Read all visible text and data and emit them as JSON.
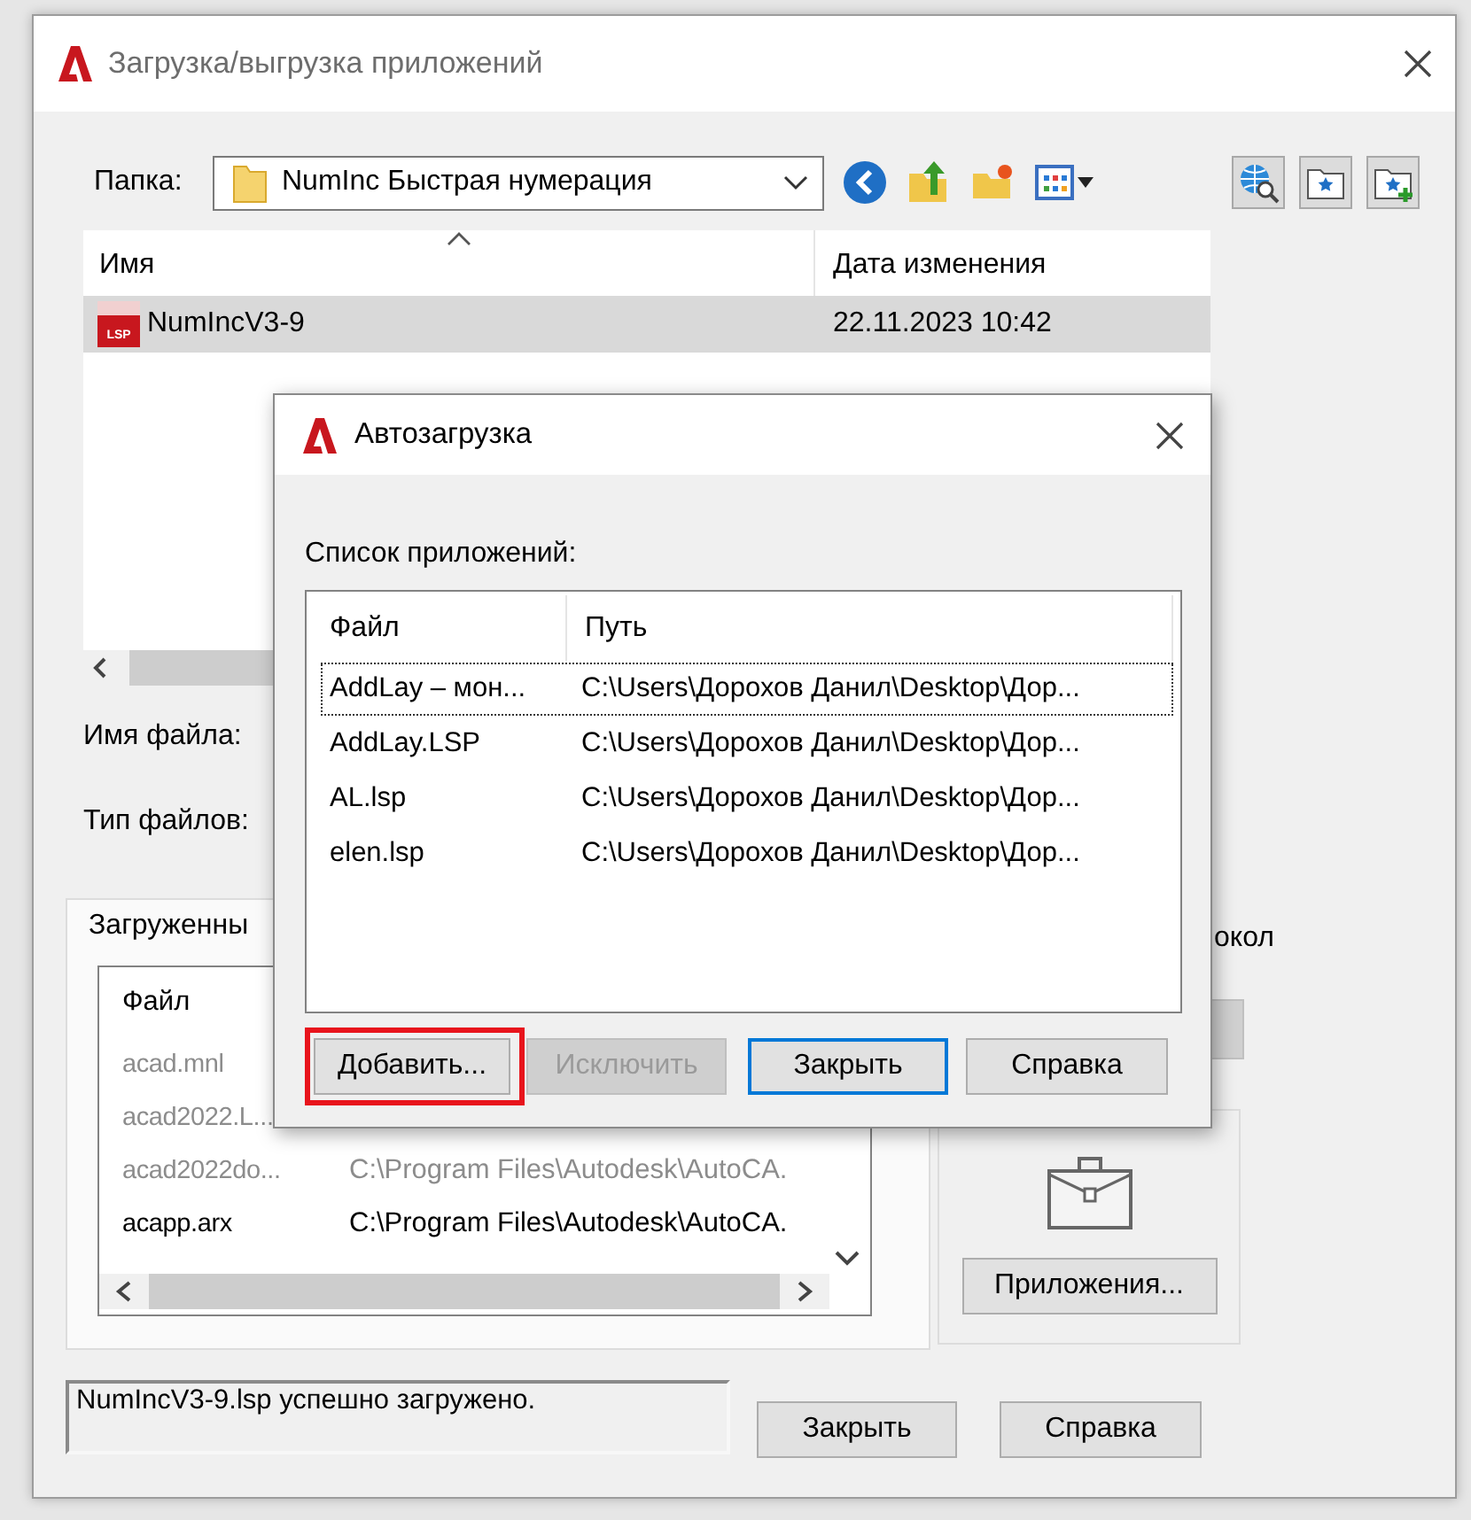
{
  "window": {
    "title": "Загрузка/выгрузка приложений"
  },
  "folder": {
    "label": "Папка:",
    "value": "NumInc Быстрая нумерация"
  },
  "file_list": {
    "columns": [
      "Имя",
      "Дата изменения"
    ],
    "rows": [
      {
        "name": "NumIncV3-9",
        "type": "LSP",
        "date": "22.11.2023 10:42",
        "selected": true
      }
    ]
  },
  "file_name": {
    "label": "Имя файла:"
  },
  "file_type": {
    "label": "Тип файлов:"
  },
  "loaded": {
    "tab": "Загруженны",
    "columns": [
      "Файл"
    ],
    "rows": [
      {
        "file": "acad.mnl",
        "dimmed": true
      },
      {
        "file": "acad2022.L...",
        "dimmed": true
      },
      {
        "file": "acad2022do...",
        "path": "C:\\Program Files\\Autodesk\\AutoCA.",
        "dimmed": true
      },
      {
        "file": "acapp.arx",
        "path": "C:\\Program Files\\Autodesk\\AutoCA.",
        "dimmed": false
      }
    ]
  },
  "side": {
    "label": "окол",
    "apps_button": "Приложения..."
  },
  "status": {
    "message": "NumIncV3-9.lsp успешно загружено."
  },
  "buttons": [
    "Закрыть",
    "Справка"
  ],
  "dialog": {
    "title": "Автозагрузка",
    "list_label": "Список приложений:",
    "columns": [
      "Файл",
      "Путь"
    ],
    "rows": [
      {
        "file": "AddLay – мон...",
        "path": "C:\\Users\\Дорохов Данил\\Desktop\\Дор...",
        "focused": true
      },
      {
        "file": "AddLay.LSP",
        "path": "C:\\Users\\Дорохов Данил\\Desktop\\Дор...",
        "focused": false
      },
      {
        "file": "AL.lsp",
        "path": "C:\\Users\\Дорохов Данил\\Desktop\\Дор...",
        "focused": false
      },
      {
        "file": "elen.lsp",
        "path": "C:\\Users\\Дорохов Данил\\Desktop\\Дор...",
        "focused": false
      }
    ],
    "buttons": [
      {
        "label": "Добавить...",
        "highlighted": true,
        "disabled": false,
        "default": false
      },
      {
        "label": "Исключить",
        "highlighted": false,
        "disabled": true,
        "default": false
      },
      {
        "label": "Закрыть",
        "highlighted": false,
        "disabled": false,
        "default": true
      },
      {
        "label": "Справка",
        "highlighted": false,
        "disabled": false,
        "default": false
      }
    ]
  }
}
